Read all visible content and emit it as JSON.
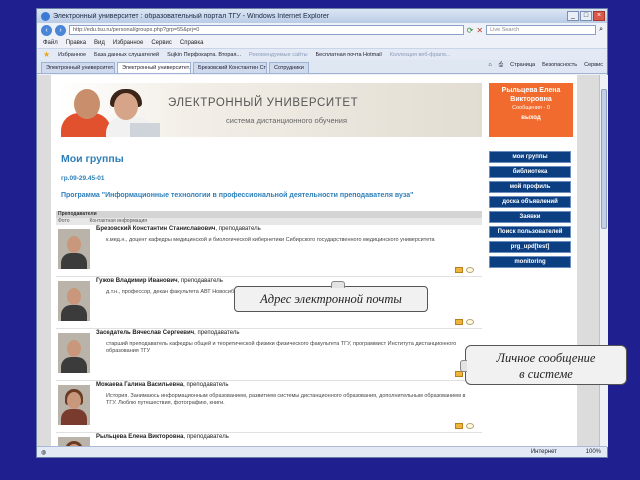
{
  "browser": {
    "title": "Электронный университет : образовательный портал ТГУ - Windows Internet Explorer",
    "url": "http://edu.tsu.ru/personal/groups.php?grp=55&prj=0",
    "search_placeholder": "Live Search",
    "menu": [
      "Файл",
      "Правка",
      "Вид",
      "Избранное",
      "Сервис",
      "Справка"
    ],
    "favorites": [
      "Избранное",
      "База данных слушателей",
      "Sujkin Перфокарта. Вторая...",
      "Рекомендуемые сайты",
      "Бесплатная почта Hotmail",
      "Коллекция веб-фрагм..."
    ],
    "tabs": [
      "Электронный университет...",
      "Электронный университет...",
      "Брезовский Константин Ст...",
      "Сотрудники"
    ],
    "toolbar": [
      "Страница",
      "Безопасность",
      "Сервис"
    ],
    "status_zone": "Интернет",
    "zoom": "100%"
  },
  "site": {
    "title": "ЭЛЕКТРОННЫЙ УНИВЕРСИТЕТ",
    "subtitle": "система дистанционного обучения",
    "user_name": "Рыльцева Елена Викторовна",
    "user_messages": "Сообщения - 0",
    "logout": "выход"
  },
  "page": {
    "title": "Мои группы",
    "group": "гр.09-29.45-01",
    "program": "Программа \"Информационные технологии в профессиональной деятельности преподавателя вуза\"",
    "table_title": "Преподаватели",
    "col_photo": "Фото",
    "col_info": "Контактная информация"
  },
  "menu": [
    "мои группы",
    "библиотека",
    "мой профиль",
    "доска объявлений",
    "Заявки",
    "Поиск пользователей",
    "prg_upd[test]",
    "monitoring"
  ],
  "teachers": [
    {
      "name": "Брезовский Константин Станиславович",
      "role": ", преподаватель",
      "info": "к.мед.н., доцент кафедры медицинской и биологической кибернетики Сибирского государственного медицинского университета"
    },
    {
      "name": "Гужов Владимир Иванович",
      "role": ", преподаватель",
      "info": "д.т.н., профессор, декан факультета АВТ Новосибирского государственного технического университета"
    },
    {
      "name": "Заседатель Вячеслав Сергеевич",
      "role": ", преподаватель",
      "info": "старший преподаватель кафедры общей и теоретической физики физического факультета ТГУ, программист Института дистанционного образования ТГУ"
    },
    {
      "name": "Можаева Галина Васильевна",
      "role": ", преподаватель",
      "info": "История. Занимаюсь информационным образованием, развитием системы дистанционного образования, дополнительным образованием в ТГУ. Люблю путешествия, фотографию, книги."
    },
    {
      "name": "Рыльцева Елена Викторовна",
      "role": ", преподаватель",
      "info": ""
    }
  ],
  "callouts": {
    "email": "Адрес электронной почты",
    "message_line1": "Личное сообщение",
    "message_line2": "в системе"
  }
}
